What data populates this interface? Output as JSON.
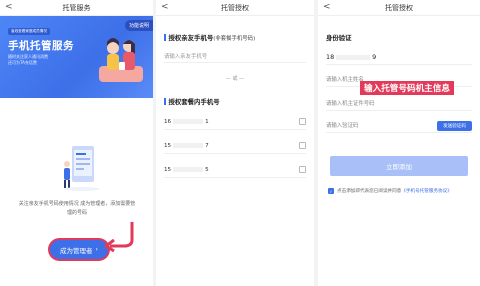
{
  "panel1": {
    "title": "托管服务",
    "back": "<",
    "help": "功能说明",
    "hero_tag": "省线查看家庭成员情况",
    "hero_title": "手机托管服务",
    "hero_sub1": "随时关注家人通讯消费",
    "hero_sub2": "还可为TA充话费",
    "desc": "关注亲友手机号码使用情况 成为管理者，添加需要管理的号码",
    "button": "成为管理者",
    "button_arrow": "›"
  },
  "panel2": {
    "title": "托管授权",
    "back": "<",
    "sec1_label": "授权亲友手机号",
    "sec1_note": "(非套餐手机号码)",
    "sec1_placeholder": "请输入亲友手机号",
    "or": "— 或 —",
    "sec2_label": "授权套餐内手机号",
    "numbers": [
      {
        "pre": "16",
        "post": "1"
      },
      {
        "pre": "15",
        "post": "7"
      },
      {
        "pre": "15",
        "post": "5"
      }
    ]
  },
  "panel3": {
    "title": "托管授权",
    "back": "<",
    "sec_label": "身份验证",
    "number_pre": "18",
    "number_post": "9",
    "name_placeholder": "请输入机主姓名",
    "id_placeholder": "请输入机主证件号码",
    "code_placeholder": "请输入验证码",
    "code_button": "发送验证码",
    "banner": "输入托管号码机主信息",
    "submit": "立即添加",
    "agree_text": "点击添加即代表您已阅读并同意",
    "agree_link": "《手机号托管服务协议》",
    "agree_check": "✓"
  },
  "colors": {
    "accent": "#3d6fe8",
    "highlight": "#e23a5a",
    "disabled": "#a8c0f7"
  }
}
